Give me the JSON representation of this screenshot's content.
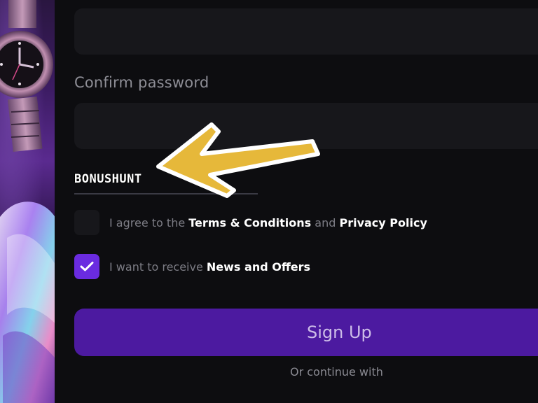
{
  "form": {
    "password_value": "",
    "confirm_label": "Confirm password",
    "confirm_value": "",
    "promo_code": "BONUSHUNT",
    "terms": {
      "prefix": "I agree to the ",
      "terms_link": "Terms & Conditions",
      "middle": " and ",
      "privacy_link": "Privacy Policy",
      "checked": false
    },
    "news": {
      "prefix": "I want to receive ",
      "bold": "News and Offers",
      "checked": true
    },
    "signup_label": "Sign Up",
    "or_continue": "Or continue with"
  },
  "colors": {
    "accent": "#6a2be0",
    "signup_button": "#4c1aa0",
    "arrow": "#e6b83a",
    "background": "#0d0d10",
    "input_bg": "#17171b"
  },
  "icons": {
    "check": "checkmark-icon",
    "arrow": "arrow-annotation",
    "banner": "watch-promo-image"
  }
}
